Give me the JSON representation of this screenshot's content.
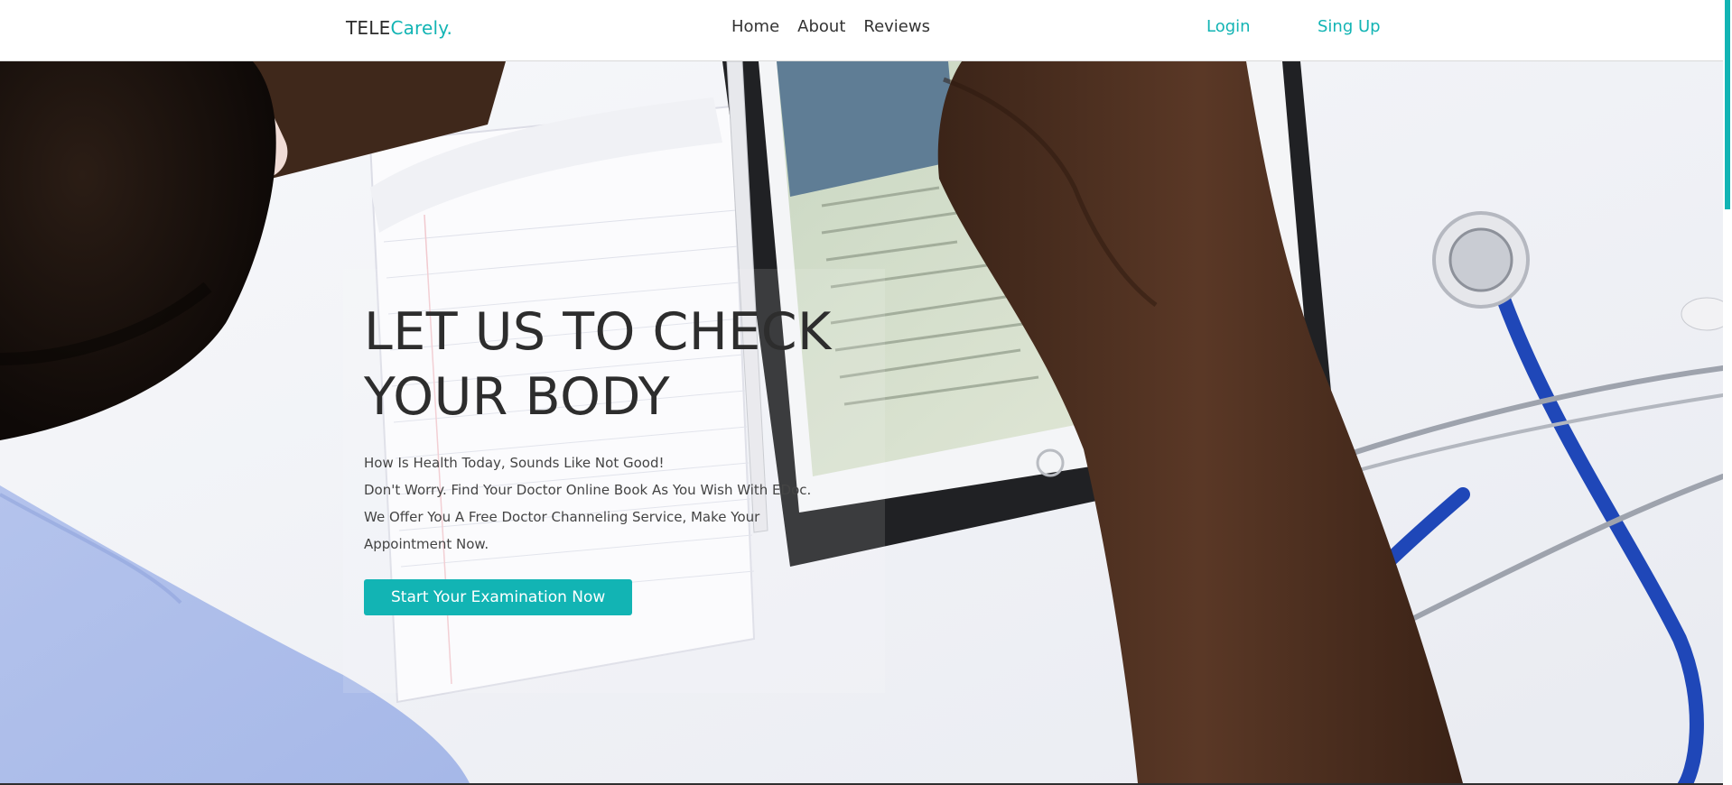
{
  "navbar": {
    "brand_part1": "TELE",
    "brand_part2": "Carely.",
    "links": [
      {
        "label": "Home"
      },
      {
        "label": "About"
      },
      {
        "label": "Reviews"
      }
    ],
    "login_label": "Login",
    "signup_label": "Sing Up"
  },
  "hero": {
    "headline_line1": "LET US TO CHECK",
    "headline_line2": "YOUR BODY",
    "description_lines": [
      "How Is Health Today, Sounds Like Not Good!",
      "Don't Worry. Find Your Doctor Online Book As You Wish With EDoc.",
      "We Offer You A Free Doctor Channeling Service, Make Your",
      "Appointment Now."
    ],
    "cta_label": "Start Your Examination Now",
    "background_image": "doctor-desk-stethoscope-tablet-photo"
  },
  "colors": {
    "accent": "#12b4b4",
    "text_dark": "#2d2d2d",
    "background": "#ffffff"
  }
}
